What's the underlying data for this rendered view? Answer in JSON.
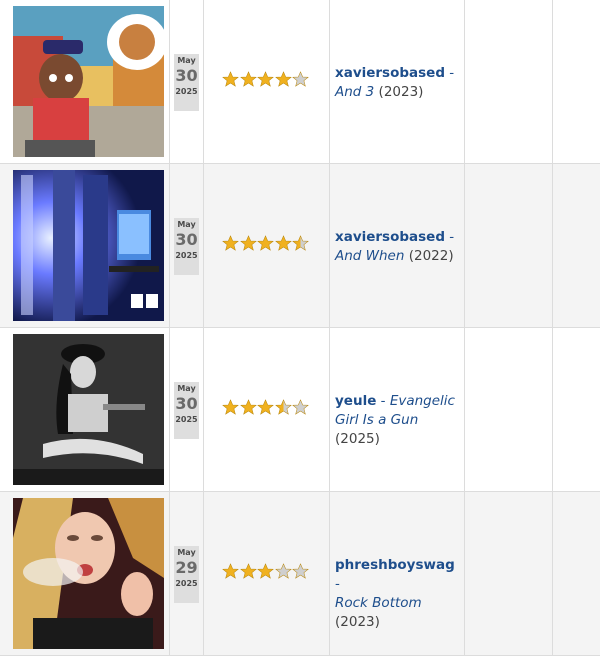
{
  "rows": [
    {
      "date": {
        "month": "May",
        "day": "30",
        "year": "2025"
      },
      "rating": 4.0,
      "artist": "xaviersobased",
      "title": "And 3",
      "year": "(2023)",
      "cover_icon": "cartoon-character-cover"
    },
    {
      "date": {
        "month": "May",
        "day": "30",
        "year": "2025"
      },
      "rating": 4.5,
      "artist": "xaviersobased",
      "title": "And When",
      "year": "(2022)",
      "cover_icon": "server-room-cover"
    },
    {
      "date": {
        "month": "May",
        "day": "30",
        "year": "2025"
      },
      "rating": 3.5,
      "artist": "yeule",
      "title": "Evangelic Girl Is a Gun",
      "year": "(2025)",
      "cover_icon": "monochrome-portrait-cover"
    },
    {
      "date": {
        "month": "May",
        "day": "29",
        "year": "2025"
      },
      "rating": 3.0,
      "artist": "phreshboyswag",
      "title": "Rock Bottom",
      "year": "(2023)",
      "cover_icon": "smoking-portrait-cover"
    }
  ],
  "colors": {
    "star_gold": "#f0b11f",
    "star_empty": "#cfcfcf",
    "link": "#1e4e8c",
    "alt_row": "#f4f4f4"
  }
}
